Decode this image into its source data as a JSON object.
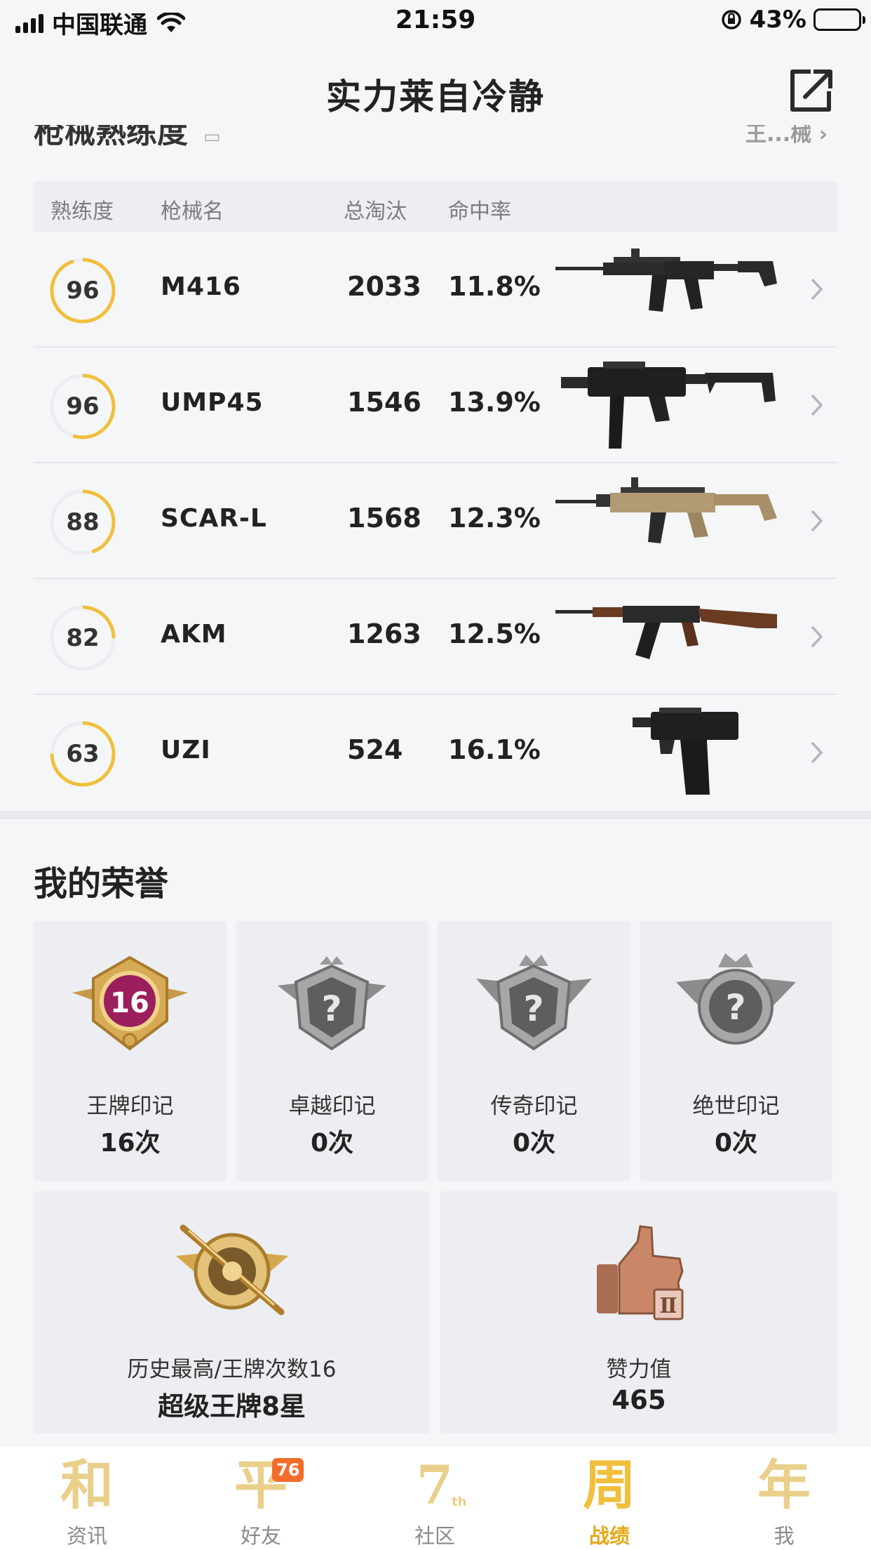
{
  "status_bar": {
    "carrier": "中国联通",
    "time": "21:59",
    "battery": "43%"
  },
  "header": {
    "title": "实力莱自冷静"
  },
  "weapon_section": {
    "title": "枪械熟练度",
    "link": "王...械",
    "columns": [
      "熟练度",
      "枪械名",
      "总淘汰",
      "命中率"
    ],
    "rows": [
      {
        "proficiency": "96",
        "proficiency_fill": 0.95,
        "name": "M416",
        "kills": "2033",
        "hit_rate": "11.8%"
      },
      {
        "proficiency": "96",
        "proficiency_fill": 0.55,
        "name": "UMP45",
        "kills": "1546",
        "hit_rate": "13.9%"
      },
      {
        "proficiency": "88",
        "proficiency_fill": 0.45,
        "name": "SCAR-L",
        "kills": "1568",
        "hit_rate": "12.3%"
      },
      {
        "proficiency": "82",
        "proficiency_fill": 0.25,
        "name": "AKM",
        "kills": "1263",
        "hit_rate": "12.5%"
      },
      {
        "proficiency": "63",
        "proficiency_fill": 0.75,
        "name": "UZI",
        "kills": "524",
        "hit_rate": "16.1%"
      }
    ]
  },
  "honors": {
    "title": "我的荣誉",
    "marks": [
      {
        "name": "王牌印记",
        "count": "16次",
        "badge_text": "16",
        "icon": "ace-mark-icon"
      },
      {
        "name": "卓越印记",
        "count": "0次",
        "badge_text": "?",
        "icon": "excellence-mark-icon"
      },
      {
        "name": "传奇印记",
        "count": "0次",
        "badge_text": "?",
        "icon": "legend-mark-icon"
      },
      {
        "name": "绝世印记",
        "count": "0次",
        "badge_text": "?",
        "icon": "peerless-mark-icon"
      }
    ],
    "best_rank": {
      "label": "历史最高/王牌次数16",
      "value": "超级王牌8星",
      "icon": "rank-badge-icon"
    },
    "likes": {
      "label": "赞力值",
      "value": "465",
      "icon": "thumbs-up-icon",
      "tier": "Ⅱ"
    }
  },
  "tab_bar": {
    "tabs": [
      {
        "glyph": "和",
        "label": "资讯"
      },
      {
        "glyph": "平",
        "label": "好友",
        "badge": "76"
      },
      {
        "glyph": "7",
        "label": "社区",
        "sub": "th"
      },
      {
        "glyph": "周",
        "label": "战绩",
        "active": true
      },
      {
        "glyph": "年",
        "label": "我"
      }
    ]
  },
  "colors": {
    "accent": "#f0bf3c",
    "ring_track": "#ecedf0",
    "badge": "#f26d2b"
  }
}
